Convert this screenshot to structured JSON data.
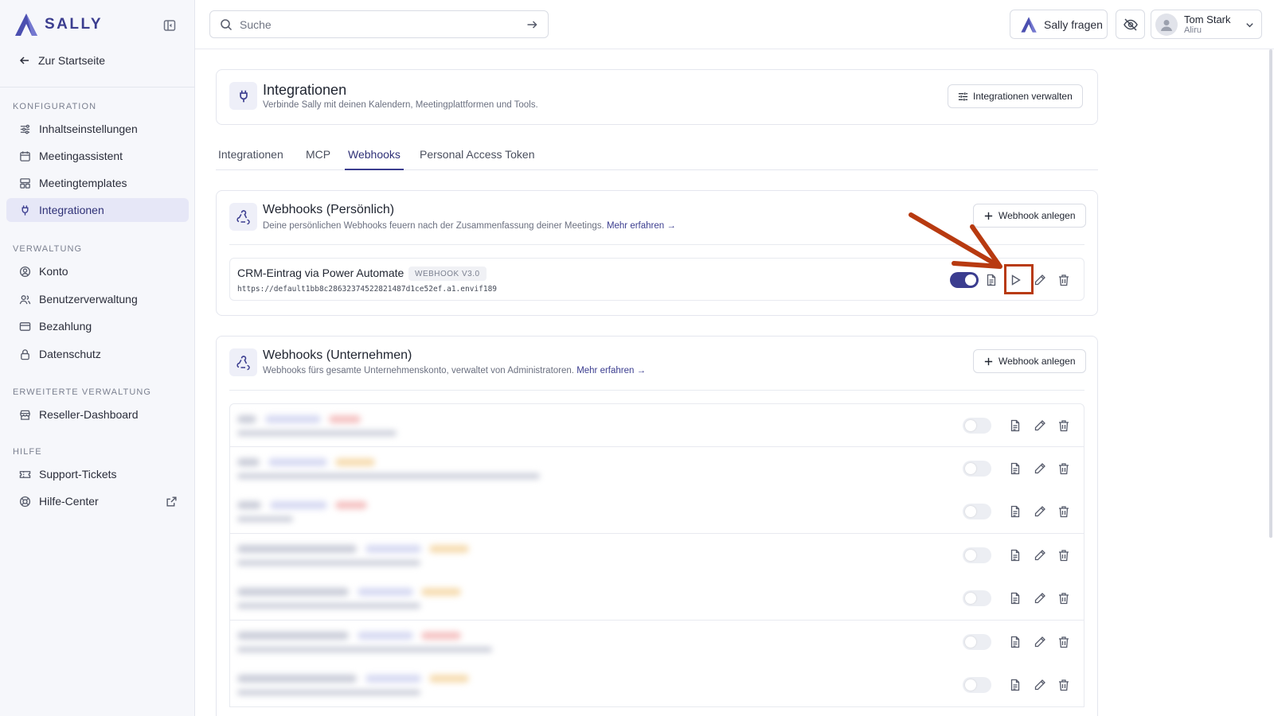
{
  "brand": {
    "name": "SALLY",
    "accent": "#3b3d8f"
  },
  "sidebar": {
    "back_label": "Zur Startseite",
    "sections": [
      {
        "title": "KONFIGURATION",
        "items": [
          {
            "label": "Inhaltseinstellungen",
            "icon": "sliders-icon"
          },
          {
            "label": "Meetingassistent",
            "icon": "calendar-icon"
          },
          {
            "label": "Meetingtemplates",
            "icon": "template-icon"
          },
          {
            "label": "Integrationen",
            "icon": "plug-icon",
            "active": true
          }
        ]
      },
      {
        "title": "VERWALTUNG",
        "items": [
          {
            "label": "Konto",
            "icon": "user-circle-icon"
          },
          {
            "label": "Benutzerverwaltung",
            "icon": "users-icon"
          },
          {
            "label": "Bezahlung",
            "icon": "credit-card-icon"
          },
          {
            "label": "Datenschutz",
            "icon": "lock-icon"
          }
        ]
      },
      {
        "title": "ERWEITERTE VERWALTUNG",
        "items": [
          {
            "label": "Reseller-Dashboard",
            "icon": "store-icon"
          }
        ]
      },
      {
        "title": "HILFE",
        "items": [
          {
            "label": "Support-Tickets",
            "icon": "ticket-icon"
          },
          {
            "label": "Hilfe-Center",
            "icon": "lifebuoy-icon",
            "external": true
          }
        ]
      }
    ]
  },
  "topbar": {
    "search_placeholder": "Suche",
    "ask_label": "Sally fragen",
    "user_name": "Tom Stark",
    "user_org": "Aliru"
  },
  "page": {
    "title": "Integrationen",
    "subtitle": "Verbinde Sally mit deinen Kalendern, Meetingplattformen und Tools.",
    "manage_label": "Integrationen verwalten"
  },
  "tabs": [
    {
      "label": "Integrationen",
      "active": false
    },
    {
      "label": "MCP",
      "active": false
    },
    {
      "label": "Webhooks",
      "active": true
    },
    {
      "label": "Personal Access Token",
      "active": false
    }
  ],
  "personal": {
    "title": "Webhooks (Persönlich)",
    "subtitle": "Deine persönlichen Webhooks feuern nach der Zusammenfassung deiner Meetings.",
    "link": "Mehr erfahren →",
    "add_label": "Webhook anlegen",
    "webhook": {
      "name": "CRM-Eintrag via Power Automate",
      "version": "WEBHOOK V3.0",
      "url": "https://default1bb8c28632374522821487d1ce52ef.a1.envif189",
      "enabled": true
    }
  },
  "company": {
    "title": "Webhooks (Unternehmen)",
    "subtitle": "Webhooks fürs gesamte Unternehmenskonto, verwaltet von Administratoren.",
    "link": "Mehr erfahren →",
    "add_label": "Webhook anlegen",
    "rows": 7
  },
  "annotation": {
    "color": "#b83a10"
  }
}
